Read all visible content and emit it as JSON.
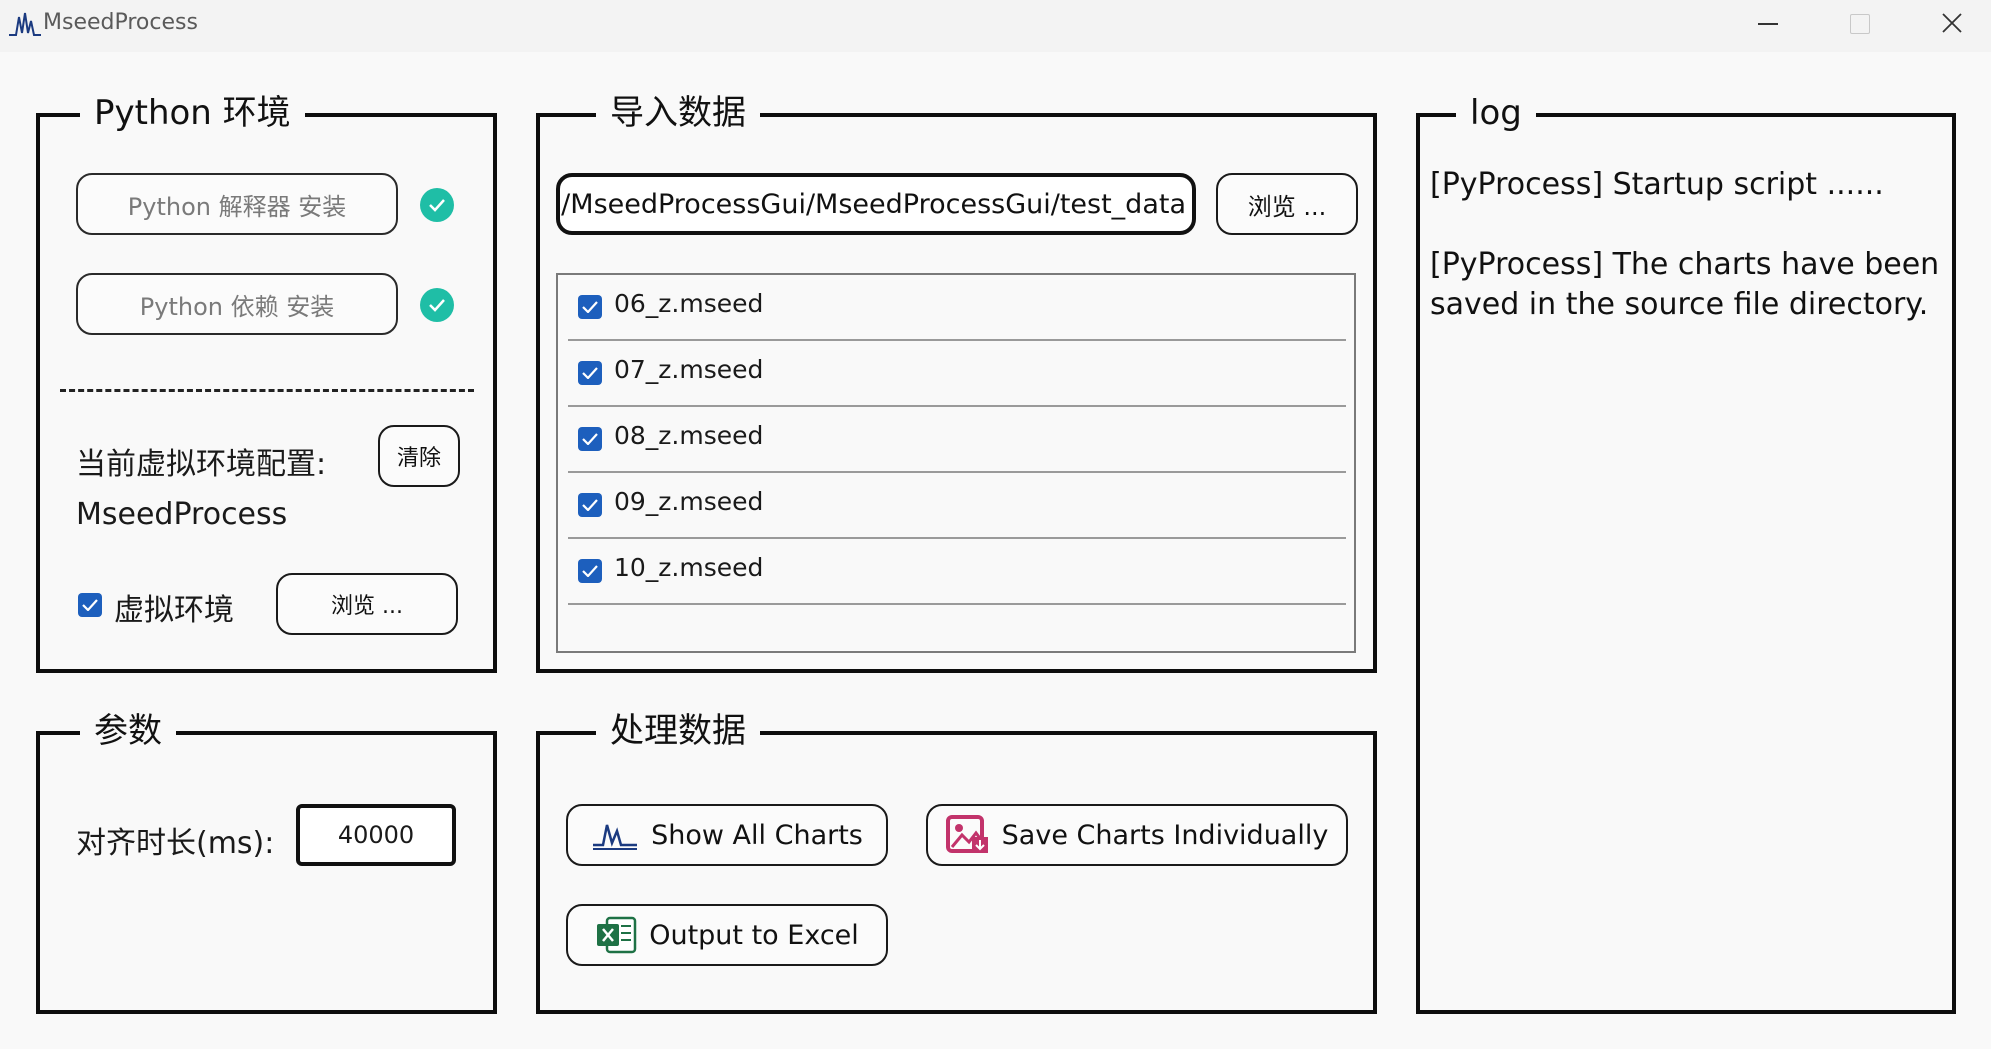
{
  "window": {
    "title": "MseedProcess",
    "icon": "waveform-icon"
  },
  "python_env": {
    "title": "Python 环境",
    "interpreter_button": "Python 解释器 安装",
    "deps_button": "Python 依赖 安装",
    "interpreter_status": "installed",
    "deps_status": "installed",
    "current_venv_label": "当前虚拟环境配置:",
    "clear_button": "清除",
    "current_venv_value": "MseedProcess",
    "venv_checkbox_label": "虚拟环境",
    "venv_checked": true,
    "browse_button": "浏览 ..."
  },
  "import_data": {
    "title": "导入数据",
    "path_value": "/Users/MseedProcessGui/MseedProcessGui/test_data",
    "browse_button": "浏览 ...",
    "files": [
      {
        "name": "06_z.mseed",
        "checked": true
      },
      {
        "name": "07_z.mseed",
        "checked": true
      },
      {
        "name": "08_z.mseed",
        "checked": true
      },
      {
        "name": "09_z.mseed",
        "checked": true
      },
      {
        "name": "10_z.mseed",
        "checked": true
      }
    ]
  },
  "log": {
    "title": "log",
    "lines": [
      "[PyProcess] Startup script ......",
      "[PyProcess] The charts have been saved in the source file directory."
    ]
  },
  "params": {
    "title": "参数",
    "align_label": "对齐时长(ms):",
    "align_value": "40000"
  },
  "process": {
    "title": "处理数据",
    "show_all_charts": "Show All Charts",
    "save_charts": "Save Charts Individually",
    "output_excel": "Output to Excel"
  },
  "colors": {
    "accent_checkbox": "#1d5fbd",
    "status_ok": "#1fbea6",
    "excel_green": "#1e7145",
    "save_pink": "#c2336b"
  }
}
